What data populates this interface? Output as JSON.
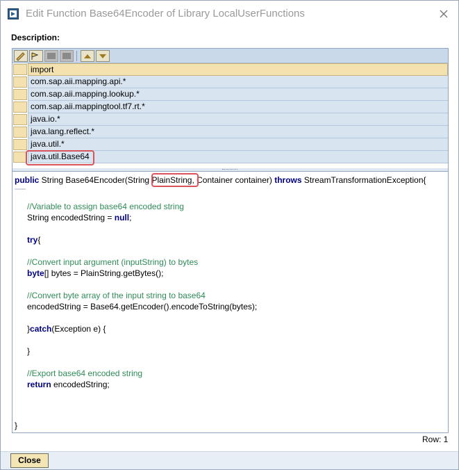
{
  "window": {
    "title": "Edit Function Base64Encoder of Library LocalUserFunctions"
  },
  "description_label": "Description:",
  "imports": {
    "header": "import",
    "rows": [
      "com.sap.aii.mapping.api.*",
      "com.sap.aii.mapping.lookup.*",
      "com.sap.aii.mappingtool.tf7.rt.*",
      "java.io.*",
      "java.lang.reflect.*",
      "java.util.*",
      "java.util.Base64"
    ]
  },
  "code": {
    "sig_kw_public": "public",
    "sig_part1": " String Base64Encoder(String ",
    "sig_param": "PlainString",
    "sig_part2": ", Container container) ",
    "sig_kw_throws": "throws",
    "sig_part3": " StreamTransformationException{",
    "c1": "//Variable to assign base64 encoded string",
    "l2_a": "String encodedString = ",
    "l2_kw": "null",
    "l2_b": ";",
    "l3_kw": "try",
    "l3_b": "{",
    "c2": "//Convert input argument (inputString) to bytes",
    "l5_kw": "byte",
    "l5_b": "[] bytes = PlainString.getBytes();",
    "c3": "//Convert byte array of the input string to base64",
    "l7": "encodedString = Base64.getEncoder().encodeToString(bytes);",
    "l8_a": "}",
    "l8_kw": "catch",
    "l8_b": "(Exception e) {",
    "l9": "}",
    "c4": "//Export base64 encoded string",
    "l11_kw": "return",
    "l11_b": " encodedString;",
    "l12": "}"
  },
  "status": {
    "row": "Row: 1"
  },
  "buttons": {
    "close": "Close"
  },
  "colors": {
    "highlight": "#d9545a",
    "keyword": "#000080",
    "comment": "#2e8b57"
  }
}
